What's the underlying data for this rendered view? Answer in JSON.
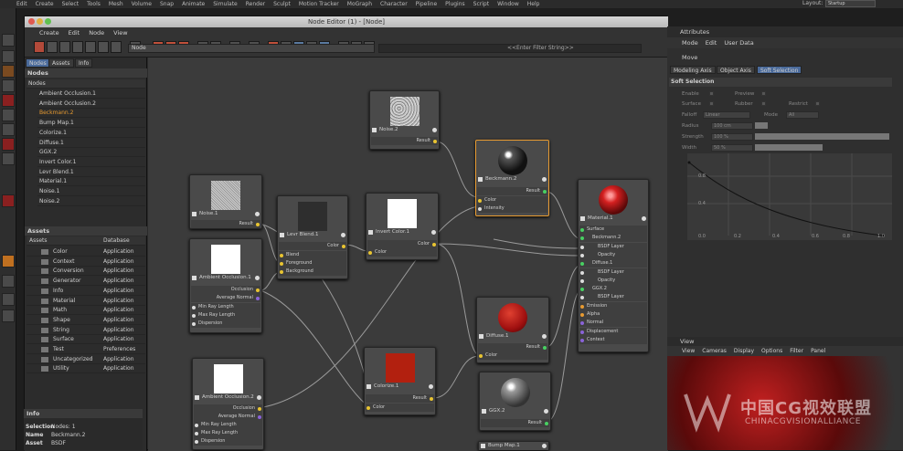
{
  "app": {
    "menubar": [
      "Edit",
      "Create",
      "Select",
      "Tools",
      "Mesh",
      "Volume",
      "Snap",
      "Animate",
      "Simulate",
      "Render",
      "Sculpt",
      "Motion Tracker",
      "MoGraph",
      "Character",
      "Pipeline",
      "Plugins",
      "Script",
      "Window",
      "Help"
    ],
    "layout_label": "Layout:",
    "layout_value": "Startup"
  },
  "editor": {
    "title": "Node Editor (1) - [Node]",
    "menu": [
      "Create",
      "Edit",
      "Node",
      "View"
    ],
    "breadcrumb": "Node",
    "filter_placeholder": "<<Enter Filter String>>"
  },
  "left_panel": {
    "tabs": [
      "Nodes",
      "Assets",
      "Info"
    ],
    "nodes_header": "Nodes",
    "nodes_subheader": "Nodes",
    "nodes": [
      "Ambient Occlusion.1",
      "Ambient Occlusion.2",
      "Beckmann.2",
      "Bump Map.1",
      "Colorize.1",
      "Diffuse.1",
      "GGX.2",
      "Invert Color.1",
      "Levr Blend.1",
      "Material.1",
      "Noise.1",
      "Noise.2"
    ],
    "selected_node": "Beckmann.2",
    "assets_header": "Assets",
    "assets_columns": [
      "Assets",
      "Database"
    ],
    "assets": [
      {
        "name": "Color",
        "db": "Application"
      },
      {
        "name": "Context",
        "db": "Application"
      },
      {
        "name": "Conversion",
        "db": "Application"
      },
      {
        "name": "Generator",
        "db": "Application"
      },
      {
        "name": "Info",
        "db": "Application"
      },
      {
        "name": "Material",
        "db": "Application"
      },
      {
        "name": "Math",
        "db": "Application"
      },
      {
        "name": "Shape",
        "db": "Application"
      },
      {
        "name": "String",
        "db": "Application"
      },
      {
        "name": "Surface",
        "db": "Application"
      },
      {
        "name": "Test",
        "db": "Preferences"
      },
      {
        "name": "Uncategorized",
        "db": "Application"
      },
      {
        "name": "Utility",
        "db": "Application"
      }
    ],
    "info_header": "Info",
    "info": [
      {
        "k": "Selection",
        "v": "Nodes: 1"
      },
      {
        "k": "Name",
        "v": "Beckmann.2"
      },
      {
        "k": "Asset",
        "v": "BSDF"
      }
    ]
  },
  "nodes": {
    "noise2": {
      "title": "Noise.2",
      "ports_out": [
        "Result"
      ]
    },
    "noise1": {
      "title": "Noise.1",
      "ports_out": [
        "Result"
      ]
    },
    "ao1": {
      "title": "Ambient Occlusion.1",
      "ports_out": [
        "Occlusion",
        "Average Normal"
      ],
      "ports_in": [
        "Min Ray Length",
        "Max Ray Length",
        "Dispersion"
      ]
    },
    "levr": {
      "title": "Levr Blend.1",
      "ports_out": [
        "Color"
      ],
      "ports_in": [
        "Blend",
        "Foreground",
        "Background"
      ]
    },
    "invert": {
      "title": "Invert Color.1",
      "ports_out": [
        "Color"
      ],
      "ports_in": [
        "Color"
      ]
    },
    "beck": {
      "title": "Beckmann.2",
      "ports_out": [
        "Result"
      ],
      "ports_in": [
        "Color",
        "Intensity"
      ]
    },
    "material": {
      "title": "Material.1",
      "ports_in": [
        "Surface",
        "Beckmann.2",
        "BSDF Layer",
        "Opacity",
        "Diffuse.1",
        "BSDF Layer",
        "Opacity",
        "GGX.2",
        "BSDF Layer",
        "Emission",
        "Alpha",
        "Normal",
        "Displacement",
        "Context"
      ]
    },
    "ao2": {
      "title": "Ambient Occlusion.2",
      "ports_out": [
        "Occlusion",
        "Average Normal"
      ],
      "ports_in": [
        "Min Ray Length",
        "Max Ray Length",
        "Dispersion"
      ]
    },
    "colorize": {
      "title": "Colorize.1",
      "ports_out": [
        "Result"
      ],
      "ports_in": [
        "Color"
      ]
    },
    "diffuse": {
      "title": "Diffuse.1",
      "ports_out": [
        "Result"
      ],
      "ports_in": [
        "Color"
      ]
    },
    "ggx": {
      "title": "GGX.2",
      "ports_out": [
        "Result"
      ]
    },
    "bump": {
      "title": "Bump Map.1"
    }
  },
  "attributes": {
    "title": "Attributes",
    "menu": [
      "Mode",
      "Edit",
      "User Data"
    ],
    "tool": "Move",
    "tabs": [
      "Modeling Axis",
      "Object Axis",
      "Soft Selection"
    ],
    "active_tab": "Soft Selection",
    "section": "Soft Selection",
    "enable_label": "Enable",
    "preview_label": "Preview",
    "surface_label": "Surface",
    "rubber_label": "Rubber",
    "restrict_label": "Restrict",
    "falloff_label": "Falloff",
    "falloff_value": "Linear",
    "mode_label": "Mode",
    "mode_value": "All",
    "radius_label": "Radius",
    "radius_value": "100 cm",
    "strength_label": "Strength",
    "strength_value": "100 %",
    "width_label": "Width",
    "width_value": "50 %",
    "strength_fill": 1.0,
    "width_fill": 0.5,
    "graph_y": [
      "0.8",
      "0.4"
    ],
    "graph_x": [
      "0.0",
      "0.2",
      "0.4",
      "0.6",
      "0.8",
      "1.0"
    ]
  },
  "viewport": {
    "title": "View",
    "menu": [
      "View",
      "Cameras",
      "Display",
      "Options",
      "Filter",
      "Panel"
    ]
  },
  "watermark": {
    "cn": "中国CG视效联盟",
    "en": "CHINACGVISIONALLIANCE"
  },
  "colors": {
    "port_color": "#e8c431",
    "port_result": "#48d062",
    "port_normal": "#8a63d8",
    "selected": "#e89b31"
  }
}
